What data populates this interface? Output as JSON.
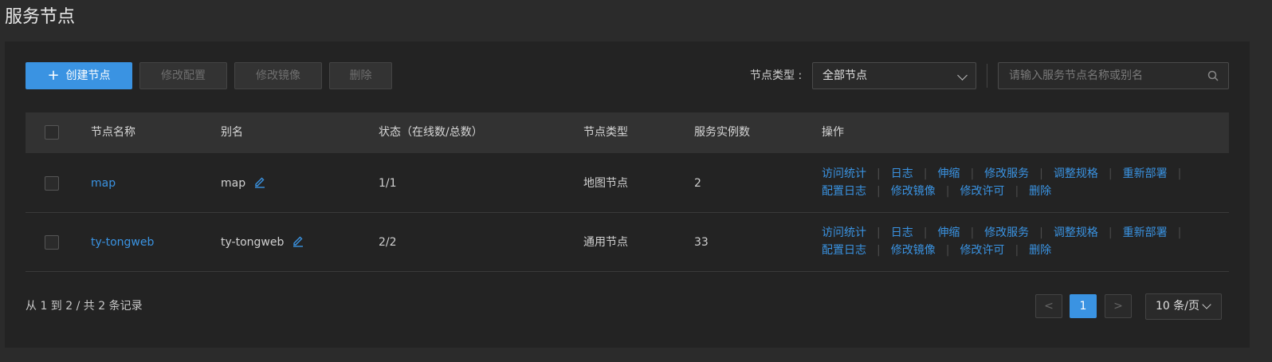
{
  "page": {
    "title": "服务节点"
  },
  "toolbar": {
    "create_label": "创建节点",
    "modify_config_label": "修改配置",
    "modify_image_label": "修改镜像",
    "delete_label": "删除",
    "filter_label": "节点类型 :",
    "node_type_value": "全部节点",
    "search_placeholder": "请输入服务节点名称或别名"
  },
  "table": {
    "headers": {
      "name": "节点名称",
      "alias": "别名",
      "status": "状态（在线数/总数）",
      "type": "节点类型",
      "instances": "服务实例数",
      "actions": "操作"
    },
    "rows": [
      {
        "name": "map",
        "alias": "map",
        "status": "1/1",
        "type": "地图节点",
        "instances": "2"
      },
      {
        "name": "ty-tongweb",
        "alias": "ty-tongweb",
        "status": "2/2",
        "type": "通用节点",
        "instances": "33"
      }
    ],
    "actions_line1": [
      "访问统计",
      "日志",
      "伸缩",
      "修改服务",
      "调整规格",
      "重新部署"
    ],
    "actions_line2": [
      "配置日志",
      "修改镜像",
      "修改许可",
      "删除"
    ]
  },
  "footer": {
    "summary": "从 1 到 2 / 共 2 条记录",
    "prev": "<",
    "current_page": "1",
    "next": ">",
    "page_size": "10 条/页"
  },
  "colors": {
    "accent": "#3a93e2",
    "background": "#2b2b2b",
    "panel": "#232323"
  }
}
